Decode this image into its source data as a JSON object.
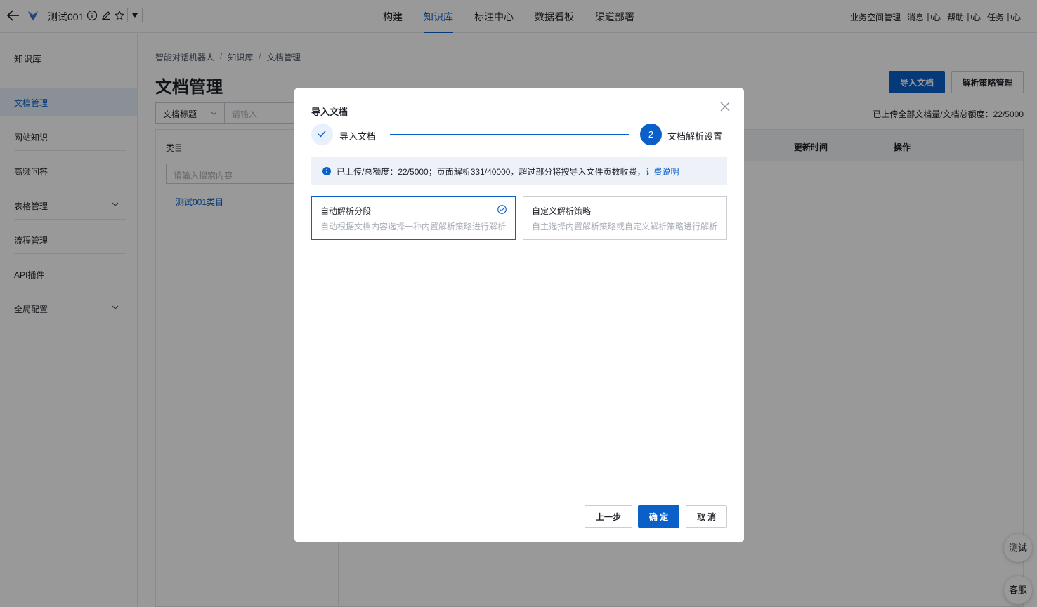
{
  "header": {
    "app_name": "测试001",
    "nav": [
      "构建",
      "知识库",
      "标注中心",
      "数据看板",
      "渠道部署"
    ],
    "active_nav": 1,
    "right_links": [
      "业务空间管理",
      "消息中心",
      "帮助中心",
      "任务中心"
    ]
  },
  "sidebar": {
    "title": "知识库",
    "items": [
      {
        "label": "文档管理"
      },
      {
        "label": "网站知识"
      },
      {
        "label": "高频问答"
      },
      {
        "label": "表格管理"
      },
      {
        "label": "流程管理"
      },
      {
        "label": "API插件"
      },
      {
        "label": "全局配置"
      }
    ]
  },
  "breadcrumb": [
    "智能对话机器人",
    "知识库",
    "文档管理"
  ],
  "page": {
    "title": "文档管理",
    "import_button": "导入文档",
    "strategy_button": "解析策略管理",
    "filter_select": "文档标题",
    "filter_placeholder": "请输入",
    "quota": "已上传全部文档量/文档总额度：22/5000"
  },
  "category_panel": {
    "header": "类目",
    "search_placeholder": "请输入搜索内容",
    "item": "测试001类目"
  },
  "table": {
    "columns": [
      "更新时间",
      "操作"
    ]
  },
  "modal": {
    "title": "导入文档",
    "steps": [
      {
        "label": "导入文档",
        "status": "done"
      },
      {
        "number": "2",
        "label": "文档解析设置",
        "status": "current"
      }
    ],
    "info_text": "已上传/总额度：22/5000；页面解析331/40000，超过部分将按导入文件页数收费，",
    "info_link": "计费说明",
    "options": [
      {
        "title": "自动解析分段",
        "desc": "自动根据文档内容选择一种内置解析策略进行解析",
        "selected": true
      },
      {
        "title": "自定义解析策略",
        "desc": "自主选择内置解析策略或自定义解析策略进行解析",
        "selected": false
      }
    ],
    "buttons": {
      "prev": "上一步",
      "ok": "确 定",
      "cancel": "取 消"
    }
  },
  "floating": {
    "test": "测试",
    "service": "客服"
  },
  "colors": {
    "accent": "#0a5fc8",
    "mask": "rgba(0,0,0,0.40)",
    "info_bg": "#eef2f8",
    "selected_bg": "#e8f0fc"
  }
}
